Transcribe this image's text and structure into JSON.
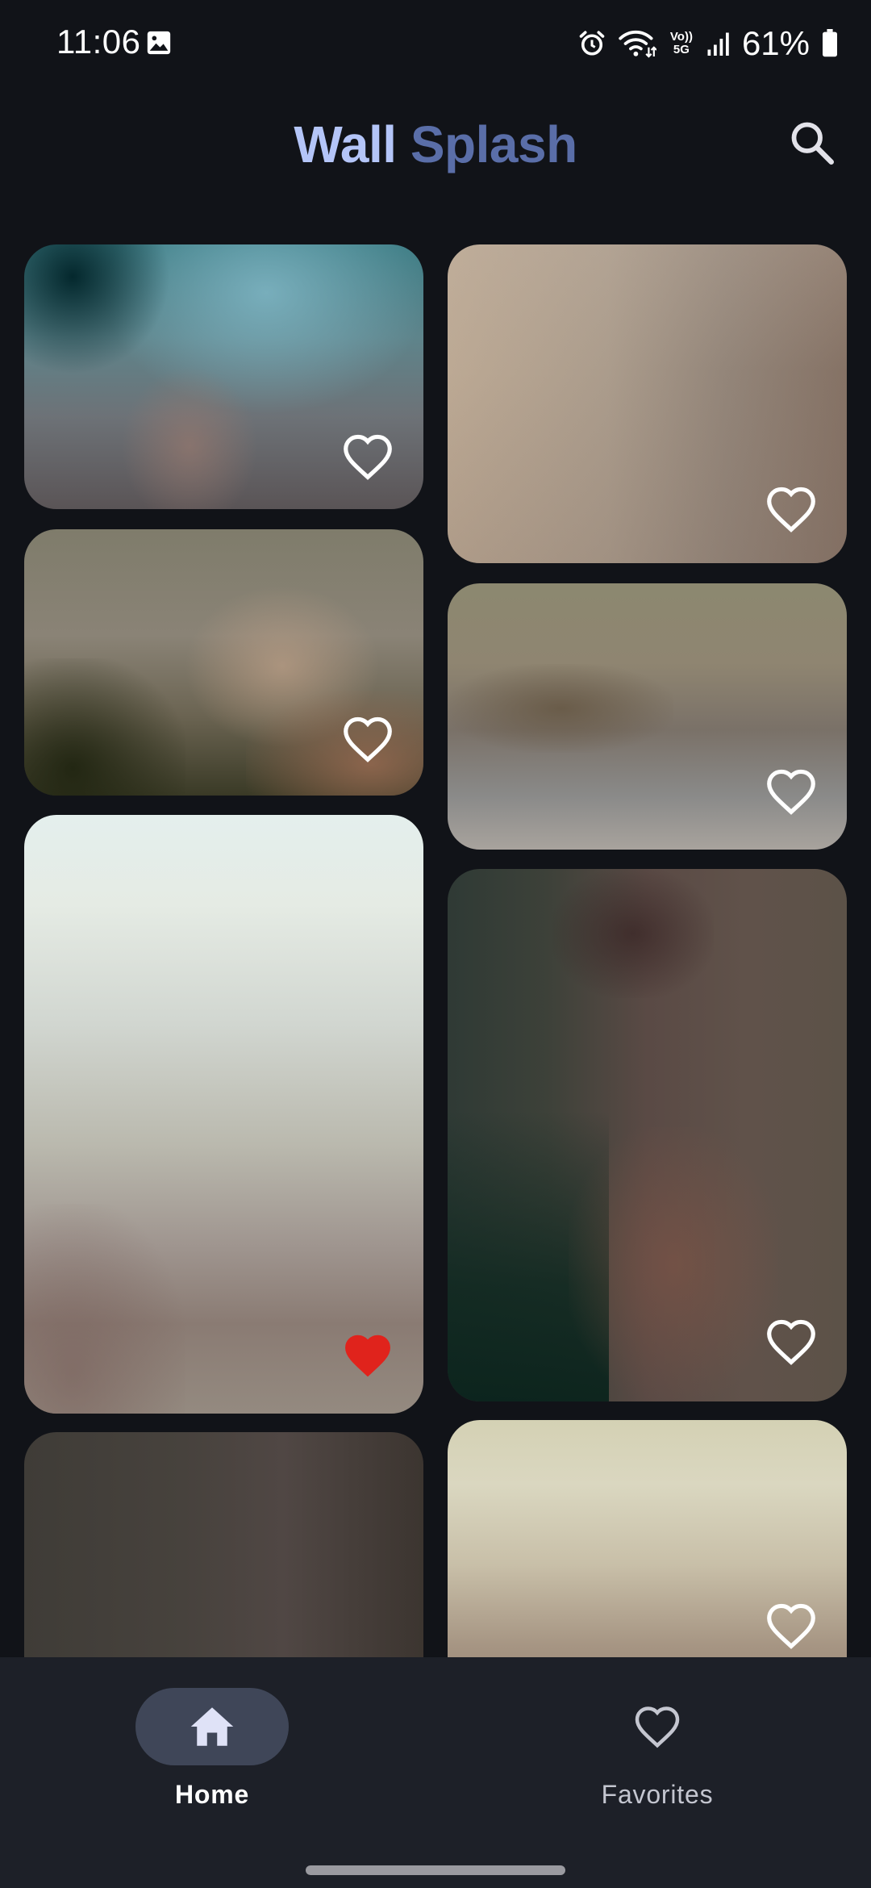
{
  "status_bar": {
    "time": "11:06",
    "network_label": "Vo)) 5G",
    "battery_percent": "61%"
  },
  "app_bar": {
    "title_part1": "Wall",
    "title_part2": "Splash",
    "title_part1_color": "#b4c5f8",
    "title_part2_color": "#5a6ea8",
    "search_icon": "search-icon"
  },
  "wallpapers": [
    {
      "column": 1,
      "favorited": false
    },
    {
      "column": 2,
      "favorited": false
    },
    {
      "column": 1,
      "favorited": false
    },
    {
      "column": 2,
      "favorited": false
    },
    {
      "column": 1,
      "favorited": true
    },
    {
      "column": 2,
      "favorited": false
    },
    {
      "column": 1,
      "favorited": false
    },
    {
      "column": 2,
      "favorited": false
    }
  ],
  "colors": {
    "favorite_active": "#e0231c",
    "favorite_inactive": "#ffffff",
    "background": "#111318",
    "nav_background": "#1d2028",
    "nav_indicator": "#3f4658"
  },
  "bottom_nav": {
    "items": [
      {
        "label": "Home",
        "icon": "home-icon",
        "selected": true
      },
      {
        "label": "Favorites",
        "icon": "heart-outline-icon",
        "selected": false
      }
    ]
  }
}
